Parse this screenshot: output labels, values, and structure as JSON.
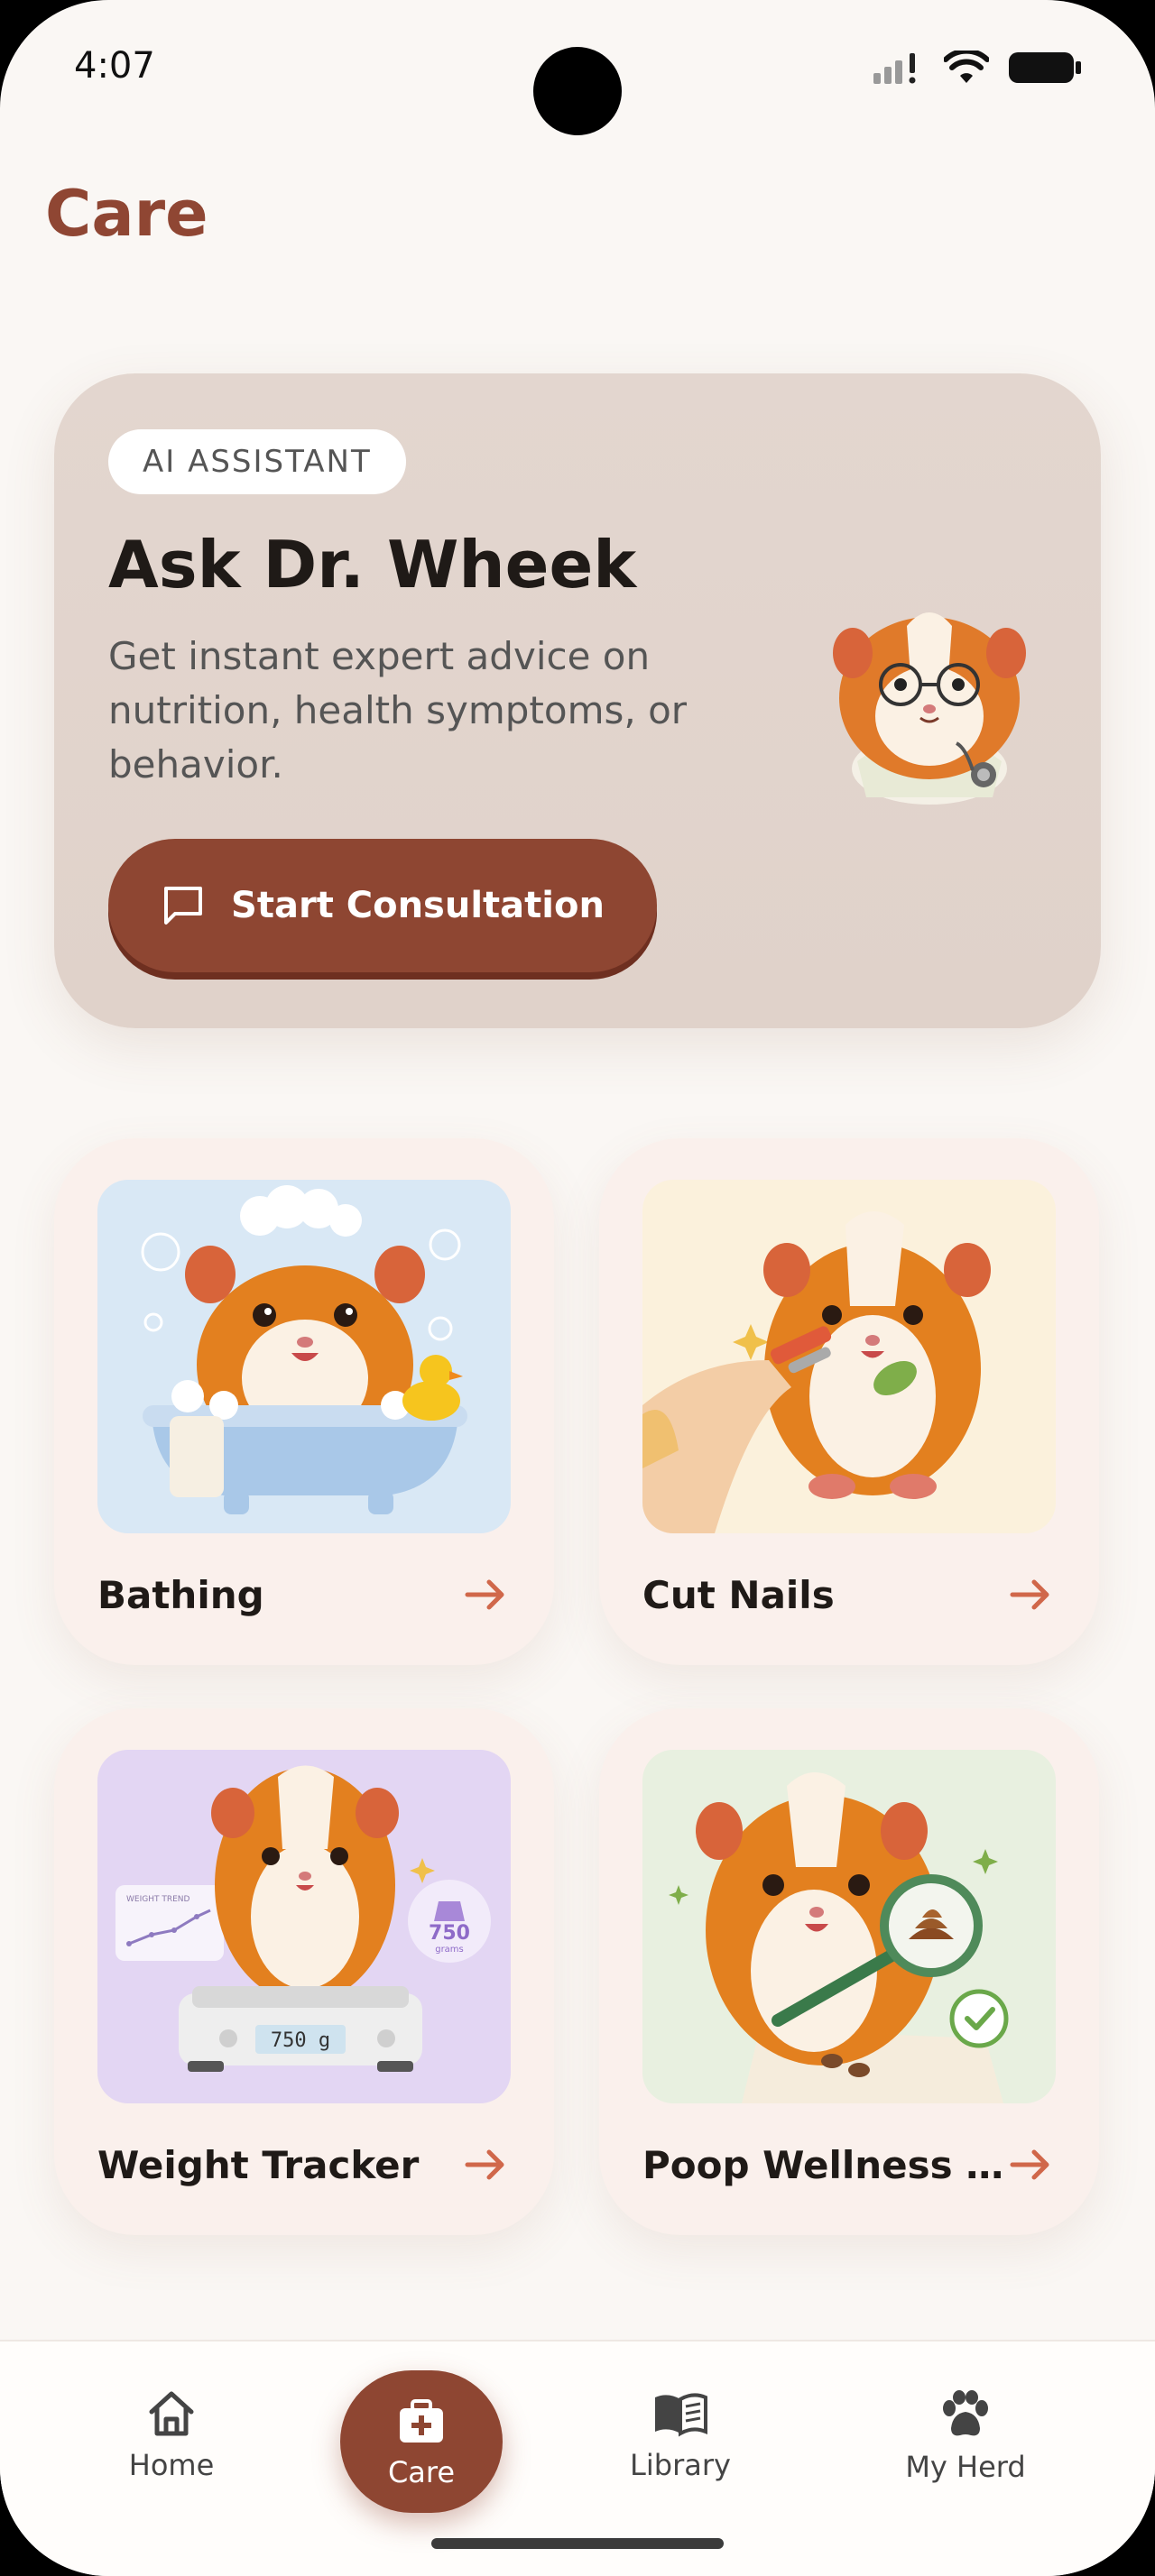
{
  "status": {
    "time": "4:07"
  },
  "page": {
    "title": "Care"
  },
  "hero": {
    "badge": "AI ASSISTANT",
    "title": "Ask Dr. Wheek",
    "description": "Get instant expert advice on nutrition, health symptoms, or behavior.",
    "button_label": "Start Consultation"
  },
  "cards": [
    {
      "label": "Bathing"
    },
    {
      "label": "Cut Nails"
    },
    {
      "label": "Weight Tracker",
      "scale_display": "750 g",
      "badge_value": "750",
      "badge_unit": "grams",
      "chart_label": "WEIGHT TREND"
    },
    {
      "label": "Poop Wellness Sc..."
    }
  ],
  "tabs": [
    {
      "label": "Home",
      "icon": "home-icon"
    },
    {
      "label": "Care",
      "icon": "first-aid-kit-icon",
      "active": true
    },
    {
      "label": "Library",
      "icon": "book-icon"
    },
    {
      "label": "My Herd",
      "icon": "paw-icon"
    }
  ],
  "colors": {
    "accent": "#8e4632",
    "background": "#faf7f4",
    "card": "#faf0ec",
    "arrow": "#d0674a"
  }
}
